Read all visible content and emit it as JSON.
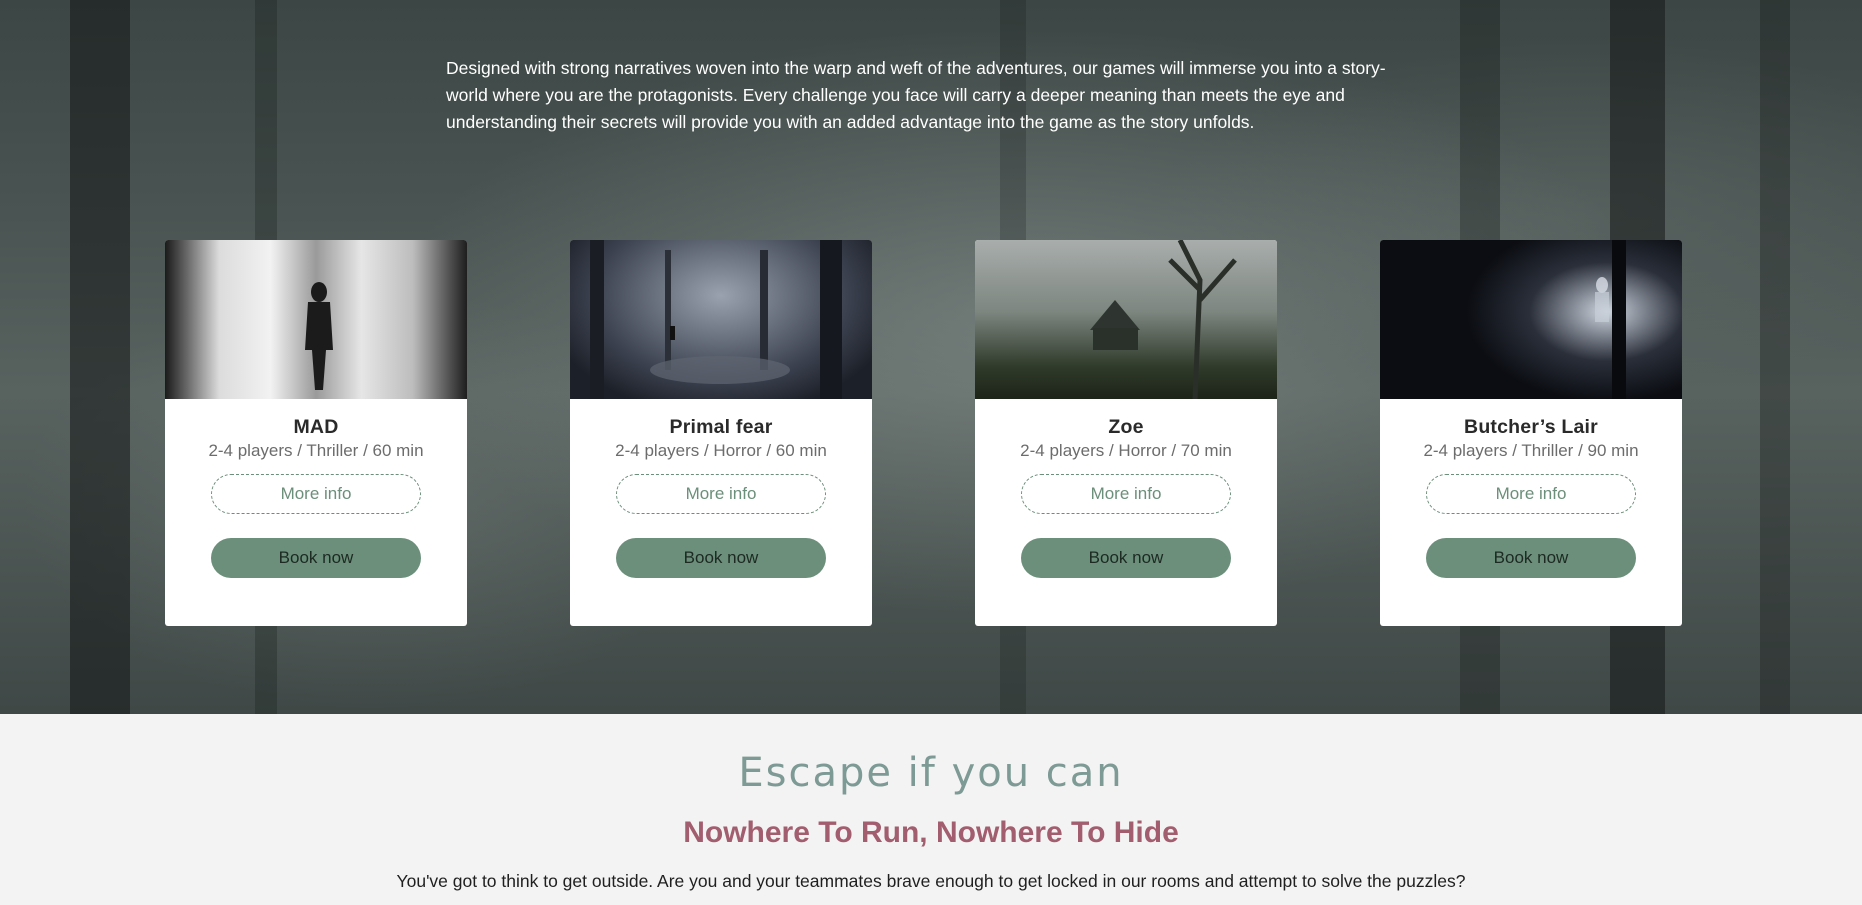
{
  "hero": {
    "description": "Designed with strong narratives woven into the warp and weft of the adventures, our games will immerse you into a story-world where you are the protagonists. Every challenge you face will carry a deeper meaning than meets the eye and understanding their secrets will provide you with an added advantage into the game as the story unfolds."
  },
  "games": [
    {
      "title": "MAD",
      "meta": "2-4 players / Thriller / 60 min",
      "more_label": "More info",
      "book_label": "Book now"
    },
    {
      "title": "Primal fear",
      "meta": "2-4 players / Horror / 60 min",
      "more_label": "More info",
      "book_label": "Book now"
    },
    {
      "title": "Zoe",
      "meta": "2-4 players / Horror / 70 min",
      "more_label": "More info",
      "book_label": "Book now"
    },
    {
      "title": "Butcher’s Lair",
      "meta": "2-4 players / Thriller / 90 min",
      "more_label": "More info",
      "book_label": "Book now"
    }
  ],
  "escape": {
    "script_title": "Escape if you can",
    "heading": "Nowhere To Run, Nowhere To Hide",
    "text": "You've got to think to get outside. Are you and your teammates brave enough to get locked in our rooms and attempt to solve the puzzles?"
  },
  "colors": {
    "accent_green": "#6b8f7a",
    "heading_rose": "#a25d6e",
    "script_teal": "#7d9a94"
  }
}
